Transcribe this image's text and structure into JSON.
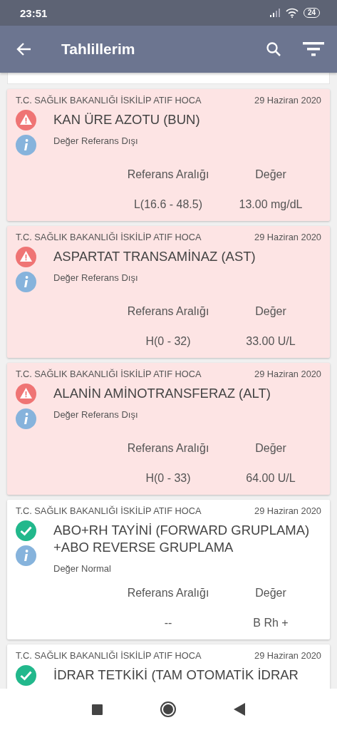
{
  "status_bar": {
    "time": "23:51",
    "battery": "24"
  },
  "app_bar": {
    "title": "Tahlillerim"
  },
  "results": [
    {
      "kind": "abnormal",
      "source": "T.C. SAĞLIK BAKANLIĞI İSKİLİP ATIF HOCA",
      "date": "29 Haziran 2020",
      "title": "KAN ÜRE AZOTU (BUN)",
      "status": "Değer Referans Dışı",
      "range_label": "Referans Aralığı",
      "value_label": "Değer",
      "range": "L(16.6 - 48.5)",
      "value": "13.00 mg/dL"
    },
    {
      "kind": "abnormal",
      "source": "T.C. SAĞLIK BAKANLIĞI İSKİLİP ATIF HOCA",
      "date": "29 Haziran 2020",
      "title": "ASPARTAT TRANSAMİNAZ (AST)",
      "status": "Değer Referans Dışı",
      "range_label": "Referans Aralığı",
      "value_label": "Değer",
      "range": "H(0 - 32)",
      "value": "33.00 U/L"
    },
    {
      "kind": "abnormal",
      "source": "T.C. SAĞLIK BAKANLIĞI İSKİLİP ATIF HOCA",
      "date": "29 Haziran 2020",
      "title": "ALANİN AMİNOTRANSFERAZ (ALT)",
      "status": "Değer Referans Dışı",
      "range_label": "Referans Aralığı",
      "value_label": "Değer",
      "range": "H(0 - 33)",
      "value": "64.00 U/L"
    },
    {
      "kind": "normal",
      "source": "T.C. SAĞLIK BAKANLIĞI İSKİLİP ATIF HOCA",
      "date": "29 Haziran 2020",
      "title": "ABO+RH TAYİNİ   (FORWARD GRUPLAMA) +ABO REVERSE GRUPLAMA",
      "status": "Değer Normal",
      "range_label": "Referans Aralığı",
      "value_label": "Değer",
      "range": "--",
      "value": "B Rh +"
    },
    {
      "kind": "normal",
      "source": "T.C. SAĞLIK BAKANLIĞI İSKİLİP ATIF HOCA",
      "date": "29 Haziran 2020",
      "title": "İDRAR TETKİKİ (TAM OTOMATİK İDRAR"
    }
  ]
}
